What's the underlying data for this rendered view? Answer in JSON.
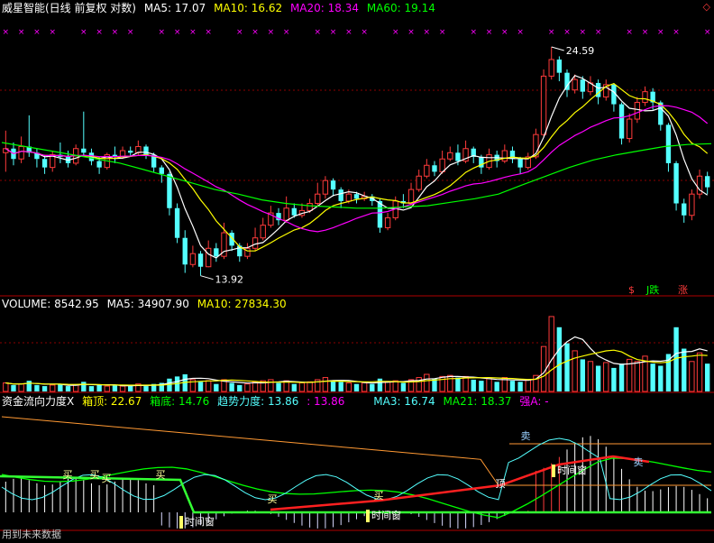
{
  "colors": {
    "bg": "#000000",
    "up": "#ff3b3b",
    "down": "#54ffff",
    "grid": "#8b0000",
    "ma5": "#ffffff",
    "ma10": "#ffff00",
    "ma20": "#ff00ff",
    "ma60": "#00ff00",
    "vol_ma5": "#ffffff",
    "vol_ma10": "#ffff00"
  },
  "panels": {
    "price": {
      "title": "威星智能(日线 前复权 对数)",
      "indicators": [
        {
          "label": "MA5: 17.07",
          "color": "#ffffff"
        },
        {
          "label": "MA10: 16.62",
          "color": "#ffff00"
        },
        {
          "label": "MA20: 18.34",
          "color": "#ff00ff"
        },
        {
          "label": "MA60: 19.14",
          "color": "#00ff00"
        }
      ],
      "high_label": "24.59",
      "low_label": "13.92",
      "markers": [
        {
          "text": "$",
          "color": "#ff3b3b"
        },
        {
          "text": "J跌",
          "color": "#00ff00"
        },
        {
          "text": "涨",
          "color": "#ff3b3b"
        }
      ],
      "corner_icon": "diamond-icon"
    },
    "volume": {
      "indicators": [
        {
          "label": "VOLUME: 8542.95",
          "color": "#ffffff"
        },
        {
          "label": "MA5: 34907.90",
          "color": "#ffffff"
        },
        {
          "label": "MA10: 27834.30",
          "color": "#ffff00"
        }
      ]
    },
    "capital": {
      "indicators": [
        {
          "label": "资金流向力度X",
          "color": "#ffffff"
        },
        {
          "label": "箱顶: 22.67",
          "color": "#ffff00"
        },
        {
          "label": "箱底: 14.76",
          "color": "#00ff00"
        },
        {
          "label": "趋势力度: 13.86",
          "color": "#54ffff"
        },
        {
          "label": ": 13.86",
          "color": "#ff00ff"
        },
        {
          "label": "MA3: 16.74",
          "color": "#54ffff"
        },
        {
          "label": "MA21: 18.37",
          "color": "#00ff00"
        },
        {
          "label": "强A: -",
          "color": "#ff00ff"
        }
      ],
      "signals": [
        "买",
        "买",
        "买",
        "买",
        "买",
        "买",
        "顶",
        "卖",
        "卖"
      ],
      "time_window_label": "时间窗"
    }
  },
  "footer_text": "用到未来数据",
  "chart_data": [
    {
      "type": "candlestick",
      "title": "威星智能(日线 前复权 对数)",
      "ylim": [
        13.0,
        26.5
      ],
      "log_scale": true,
      "grid": true,
      "annotations": {
        "high": 24.59,
        "low": 13.92
      },
      "series": [
        {
          "name": "MA5",
          "last": 17.07
        },
        {
          "name": "MA10",
          "last": 16.62
        },
        {
          "name": "MA20",
          "last": 18.34
        },
        {
          "name": "MA60",
          "last": 19.14
        }
      ],
      "ma60_path": [
        19.2,
        19.0,
        18.8,
        18.6,
        18.4,
        18.2,
        17.9,
        17.6,
        17.3,
        17.0,
        16.8,
        16.55,
        16.4,
        16.3,
        16.25,
        16.2,
        16.2,
        16.25,
        16.3,
        16.45,
        16.6,
        16.8,
        17.2,
        17.6,
        18.0,
        18.35,
        18.6,
        18.8,
        19.0,
        19.1,
        19.14
      ],
      "candles": [
        [
          18.7,
          18.9,
          19.8,
          17.8
        ],
        [
          18.9,
          18.4,
          19.2,
          18.1
        ],
        [
          18.4,
          19.0,
          19.5,
          18.2
        ],
        [
          19.0,
          18.7,
          20.6,
          18.5
        ],
        [
          18.7,
          18.4,
          18.9,
          18.0
        ],
        [
          18.4,
          18.0,
          18.6,
          17.7
        ],
        [
          18.0,
          18.6,
          18.8,
          17.8
        ],
        [
          18.6,
          18.5,
          19.2,
          18.2
        ],
        [
          18.5,
          18.2,
          18.8,
          18.0
        ],
        [
          18.2,
          18.9,
          19.1,
          18.1
        ],
        [
          18.9,
          18.7,
          20.8,
          18.5
        ],
        [
          18.7,
          18.3,
          18.9,
          18.1
        ],
        [
          18.3,
          18.0,
          18.5,
          17.7
        ],
        [
          18.0,
          18.6,
          18.7,
          17.9
        ],
        [
          18.6,
          18.5,
          19.0,
          18.2
        ],
        [
          18.5,
          18.8,
          19.0,
          18.4
        ],
        [
          18.8,
          18.7,
          19.0,
          18.5
        ],
        [
          18.7,
          19.0,
          19.3,
          18.6
        ],
        [
          19.0,
          18.6,
          19.1,
          18.4
        ],
        [
          18.6,
          18.0,
          18.7,
          17.8
        ],
        [
          18.0,
          17.7,
          18.1,
          17.3
        ],
        [
          17.7,
          16.2,
          17.8,
          15.9
        ],
        [
          16.2,
          15.0,
          16.4,
          14.8
        ],
        [
          15.0,
          14.0,
          15.3,
          13.7
        ],
        [
          14.0,
          14.4,
          14.7,
          13.9
        ],
        [
          14.4,
          13.92,
          14.5,
          13.6
        ],
        [
          13.92,
          14.6,
          14.9,
          13.9
        ],
        [
          14.6,
          14.3,
          14.8,
          14.1
        ],
        [
          14.3,
          15.2,
          15.6,
          14.2
        ],
        [
          15.2,
          14.7,
          15.3,
          14.5
        ],
        [
          14.7,
          14.3,
          14.8,
          14.1
        ],
        [
          14.3,
          14.6,
          14.8,
          14.2
        ],
        [
          14.6,
          15.0,
          15.4,
          14.5
        ],
        [
          15.0,
          15.5,
          15.8,
          14.9
        ],
        [
          15.5,
          16.0,
          16.3,
          15.4
        ],
        [
          16.0,
          15.7,
          16.2,
          15.5
        ],
        [
          15.7,
          16.2,
          16.7,
          15.6
        ],
        [
          16.2,
          15.9,
          16.4,
          15.8
        ],
        [
          15.9,
          16.1,
          16.4,
          15.8
        ],
        [
          16.1,
          16.4,
          16.6,
          16.0
        ],
        [
          16.4,
          16.8,
          17.3,
          16.3
        ],
        [
          16.8,
          17.4,
          17.6,
          16.6
        ],
        [
          17.4,
          17.0,
          17.5,
          16.7
        ],
        [
          17.0,
          16.5,
          17.1,
          16.2
        ],
        [
          16.5,
          16.8,
          17.0,
          16.4
        ],
        [
          16.8,
          16.6,
          16.9,
          16.4
        ],
        [
          16.6,
          16.7,
          16.9,
          16.5
        ],
        [
          16.7,
          16.5,
          16.8,
          16.3
        ],
        [
          16.5,
          15.4,
          16.6,
          15.2
        ],
        [
          15.4,
          15.8,
          16.0,
          15.3
        ],
        [
          15.8,
          16.5,
          16.7,
          15.7
        ],
        [
          16.5,
          16.4,
          16.8,
          16.2
        ],
        [
          16.4,
          17.0,
          17.3,
          16.3
        ],
        [
          17.0,
          17.6,
          17.9,
          16.9
        ],
        [
          17.6,
          18.1,
          18.4,
          17.5
        ],
        [
          18.1,
          17.8,
          18.3,
          17.6
        ],
        [
          17.8,
          18.4,
          18.8,
          17.7
        ],
        [
          18.4,
          18.7,
          19.0,
          18.3
        ],
        [
          18.7,
          18.3,
          19.1,
          18.1
        ],
        [
          18.3,
          18.9,
          19.3,
          18.2
        ],
        [
          18.9,
          18.5,
          19.0,
          18.2
        ],
        [
          18.5,
          18.0,
          18.6,
          17.7
        ],
        [
          18.0,
          18.6,
          18.9,
          17.9
        ],
        [
          18.6,
          18.3,
          18.8,
          18.0
        ],
        [
          18.3,
          18.8,
          19.1,
          18.2
        ],
        [
          18.8,
          18.4,
          19.0,
          18.2
        ],
        [
          18.4,
          18.0,
          18.5,
          17.7
        ],
        [
          18.0,
          18.5,
          18.7,
          17.9
        ],
        [
          18.5,
          19.6,
          19.9,
          18.4
        ],
        [
          19.6,
          22.8,
          23.2,
          19.5
        ],
        [
          22.8,
          23.8,
          24.59,
          22.6
        ],
        [
          23.8,
          23.0,
          24.0,
          22.5
        ],
        [
          23.0,
          22.0,
          23.2,
          21.6
        ],
        [
          22.0,
          22.6,
          22.9,
          21.8
        ],
        [
          22.6,
          21.9,
          22.8,
          21.5
        ],
        [
          21.9,
          22.4,
          22.8,
          21.7
        ],
        [
          22.4,
          21.6,
          22.6,
          21.2
        ],
        [
          21.6,
          22.3,
          22.6,
          21.4
        ],
        [
          22.3,
          21.2,
          22.4,
          20.8
        ],
        [
          21.2,
          19.4,
          21.3,
          19.1
        ],
        [
          19.4,
          20.4,
          20.7,
          19.2
        ],
        [
          20.4,
          21.3,
          21.6,
          20.2
        ],
        [
          21.3,
          21.9,
          22.2,
          21.1
        ],
        [
          21.9,
          21.3,
          22.1,
          20.9
        ],
        [
          21.3,
          20.1,
          21.4,
          19.8
        ],
        [
          20.1,
          18.2,
          20.2,
          17.8
        ],
        [
          18.2,
          16.4,
          18.3,
          16.1
        ],
        [
          16.4,
          15.9,
          16.6,
          15.6
        ],
        [
          15.9,
          16.8,
          17.0,
          15.7
        ],
        [
          16.8,
          17.6,
          17.9,
          16.6
        ],
        [
          17.6,
          17.1,
          17.8,
          16.8
        ]
      ]
    },
    {
      "type": "bar",
      "title": "VOLUME",
      "series": [
        {
          "name": "VOLUME",
          "last": 8542.95
        },
        {
          "name": "MA5",
          "last": 34907.9
        },
        {
          "name": "MA10",
          "last": 27834.3
        }
      ],
      "ylim": [
        0,
        75000
      ],
      "values": [
        8,
        6,
        7,
        10,
        6,
        5,
        6,
        7,
        5,
        6,
        9,
        5,
        6,
        5,
        6,
        5,
        5,
        7,
        5,
        7,
        8,
        12,
        14,
        16,
        11,
        9,
        10,
        7,
        11,
        8,
        6,
        7,
        9,
        10,
        11,
        8,
        10,
        7,
        8,
        9,
        11,
        13,
        10,
        9,
        8,
        7,
        8,
        7,
        12,
        9,
        10,
        8,
        11,
        13,
        16,
        12,
        14,
        15,
        13,
        14,
        11,
        10,
        12,
        9,
        13,
        10,
        9,
        11,
        15,
        42,
        70,
        60,
        45,
        38,
        30,
        28,
        24,
        27,
        22,
        26,
        30,
        28,
        33,
        26,
        24,
        35,
        60,
        40,
        28,
        36,
        26
      ]
    },
    {
      "type": "line",
      "title": "资金流向力度X",
      "ylim": [
        10,
        28
      ],
      "series": [
        {
          "name": "箱顶",
          "last": 22.67
        },
        {
          "name": "箱底",
          "last": 14.76
        },
        {
          "name": "趋势力度",
          "last": 13.86
        },
        {
          "name": "MA3",
          "last": 16.74
        },
        {
          "name": "MA21",
          "last": 18.37
        },
        {
          "name": "强A",
          "last": null
        }
      ]
    }
  ]
}
